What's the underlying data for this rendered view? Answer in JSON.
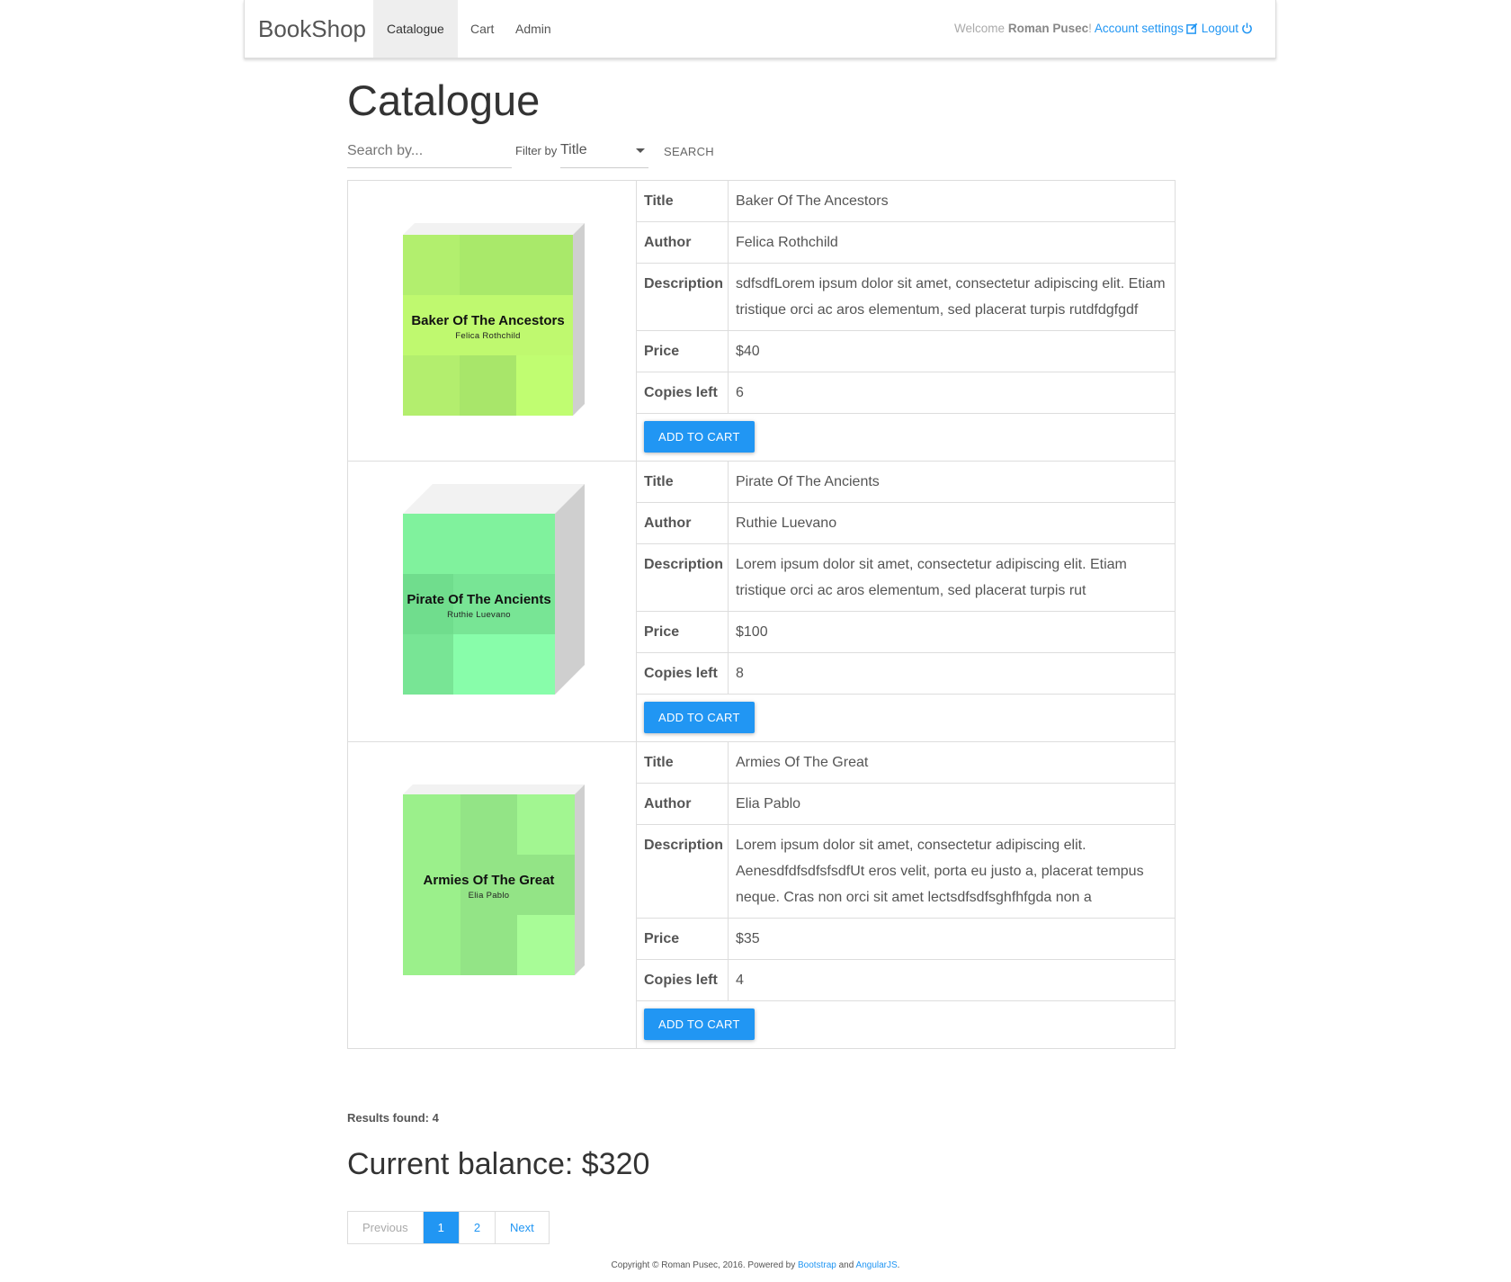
{
  "navbar": {
    "brand": "BookShop",
    "tabs": [
      {
        "label": "Catalogue",
        "active": true
      },
      {
        "label": "Cart",
        "active": false
      },
      {
        "label": "Admin",
        "active": false
      }
    ],
    "welcome_prefix": "Welcome ",
    "user_name": "Roman Pusec",
    "welcome_suffix": "! ",
    "account_settings": "Account settings",
    "logout": "Logout"
  },
  "page": {
    "title": "Catalogue",
    "search_placeholder": "Search by...",
    "filter_label": "Filter by",
    "filter_value": "Title",
    "search_button": "SEARCH"
  },
  "labels": {
    "title": "Title",
    "author": "Author",
    "description": "Description",
    "price": "Price",
    "copies": "Copies left",
    "add_to_cart": "ADD TO CART"
  },
  "books": [
    {
      "title": "Baker Of The Ancestors",
      "author": "Felica Rothchild",
      "description": "sdfsdfLorem ipsum dolor sit amet, consectetur adipiscing elit. Etiam tristique orci ac aros elementum, sed placerat turpis rutdfdgfgdf",
      "price": "$40",
      "copies": "6",
      "cover_colors": [
        "#b2ef6e",
        "#a9e96a",
        "#a9e96a",
        "#bff96f",
        "#bff96f",
        "#bff96f",
        "#b3ee6e",
        "#a8e66a",
        "#c0fd71"
      ]
    },
    {
      "title": "Pirate Of The Ancients",
      "author": "Ruthie Luevano",
      "description": "Lorem ipsum dolor sit amet, consectetur adipiscing elit. Etiam tristique orci ac aros elementum, sed placerat turpis rut",
      "price": "$100",
      "copies": "8",
      "cover_colors": [
        "#80f29d",
        "#80f29d",
        "#80f29d",
        "#70dd8d",
        "#78e595",
        "#78e595",
        "#78e595",
        "#88fdaa",
        "#88fdaa"
      ]
    },
    {
      "title": "Armies Of The Great",
      "author": "Elia Pablo",
      "description": "Lorem ipsum dolor sit amet, consectetur adipiscing elit. AenesdfdfsdfsfsdfUt eros velit, porta eu justo a, placerat tempus neque. Cras non orci sit amet lectsdfsdfsghfhfgda non a",
      "price": "$35",
      "copies": "4",
      "cover_colors": [
        "#9bf08b",
        "#93e486",
        "#a2f691",
        "#9bf08b",
        "#93e486",
        "#93e486",
        "#9bf08b",
        "#93e486",
        "#a8fc97"
      ]
    }
  ],
  "results": "Results found: 4",
  "balance": "Current balance: $320",
  "pagination": [
    "Previous",
    "1",
    "2",
    "Next"
  ],
  "footer": {
    "text_before": "Copyright © Roman Pusec, 2016. Powered by ",
    "link1": "Bootstrap",
    "and": " and ",
    "link2": "AngularJS",
    "end": "."
  },
  "colors": {
    "accent": "#2196f3",
    "nav_active_bg": "#eeeeee",
    "border": "#dddddd"
  }
}
